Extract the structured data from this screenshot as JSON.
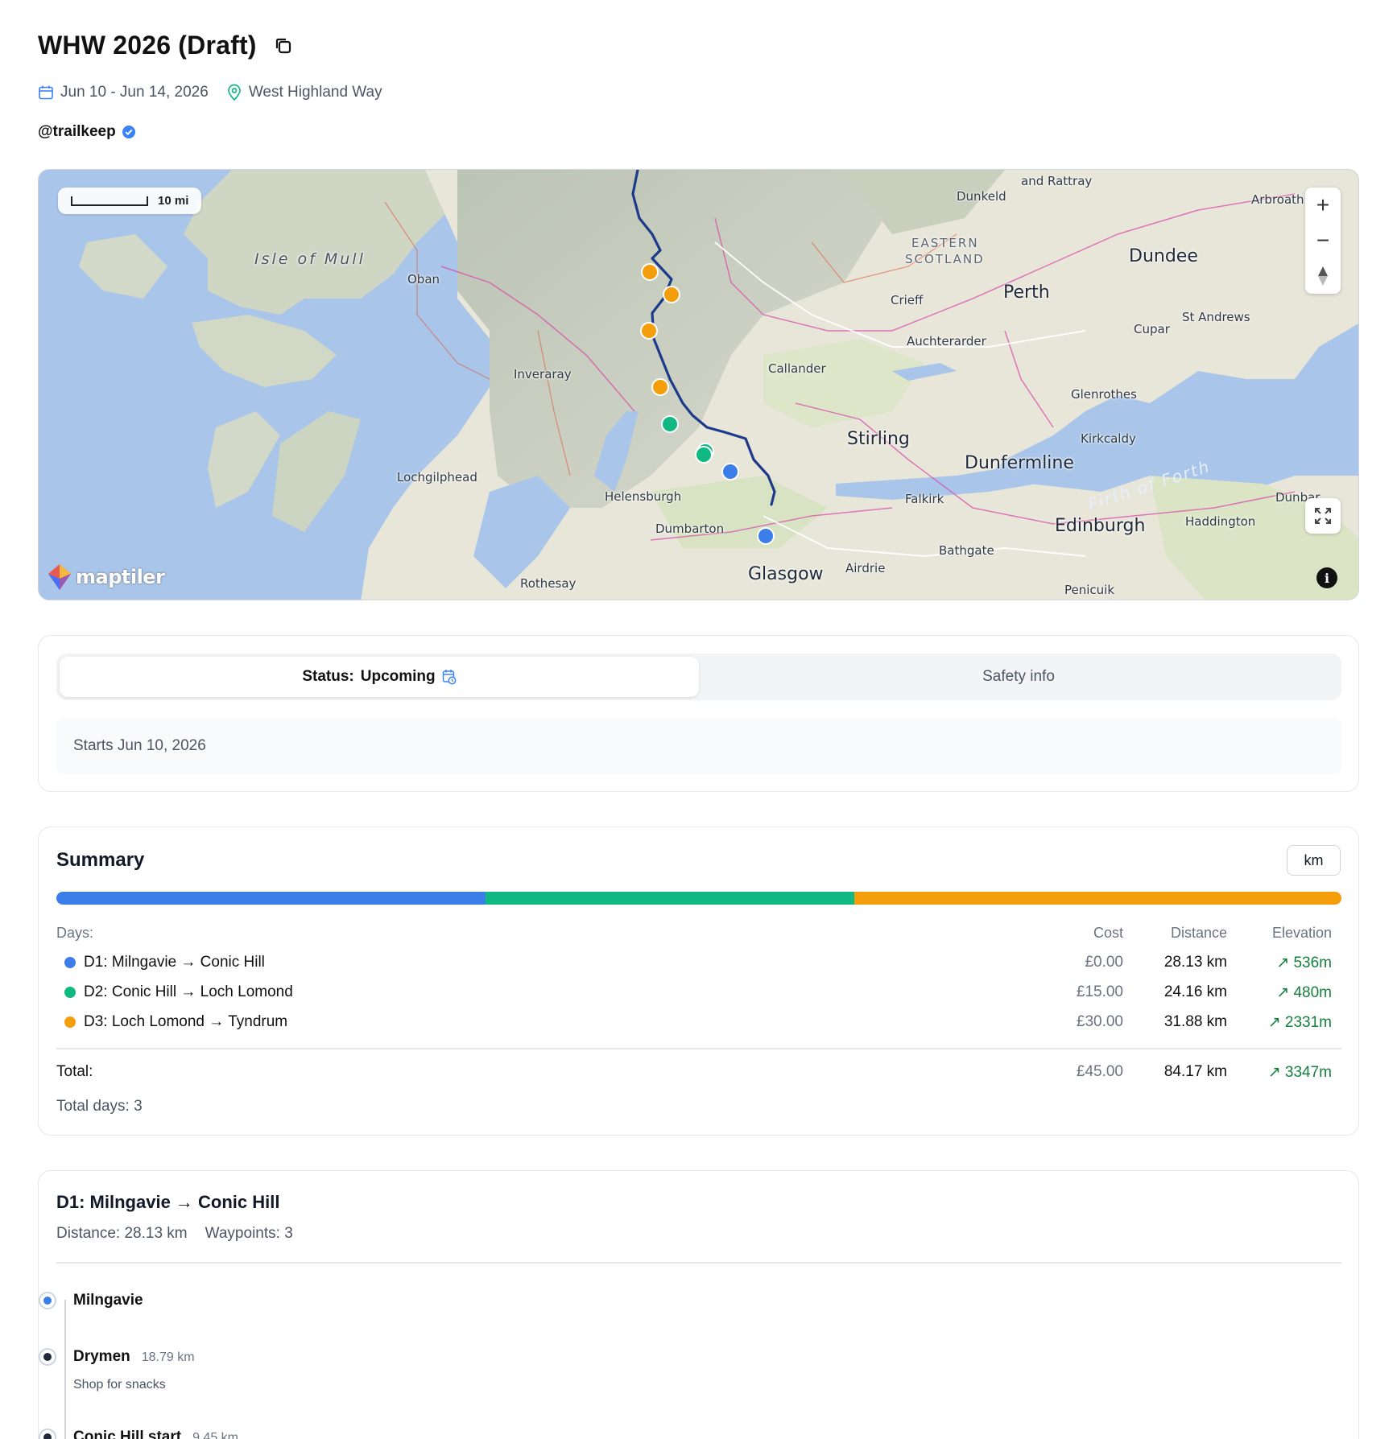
{
  "trip": {
    "title": "WHW 2026 (Draft)",
    "dates": "Jun 10 - Jun 14, 2026",
    "location": "West Highland Way",
    "user": "@trailkeep"
  },
  "map": {
    "scale_label": "10 mi",
    "attribution": "maptiler",
    "labels": {
      "isle_of_mull": "Isle of Mull",
      "oban": "Oban",
      "inveraray": "Inveraray",
      "lochgilphead": "Lochgilphead",
      "helensburgh": "Helensburgh",
      "dumbarton": "Dumbarton",
      "rothesay": "Rothesay",
      "glasgow": "Glasgow",
      "airdrie": "Airdrie",
      "bathgate": "Bathgate",
      "penicuik": "Penicuik",
      "edinburgh": "Edinburgh",
      "haddington": "Haddington",
      "dunbar": "Dunbar",
      "falkirk": "Falkirk",
      "stirling": "Stirling",
      "dunfermline": "Dunfermline",
      "firth_of_forth": "Firth of Forth",
      "kirkcaldy": "Kirkcaldy",
      "glenrothes": "Glenrothes",
      "callander": "Callander",
      "auchterarder": "Auchterarder",
      "crieff": "Crieff",
      "perth": "Perth",
      "cupar": "Cupar",
      "st_andrews": "St Andrews",
      "dundee": "Dundee",
      "arbroath": "Arbroath",
      "dunkeld": "Dunkeld",
      "eastern_scotland_1": "EASTERN",
      "eastern_scotland_2": "SCOTLAND",
      "and_rattray": "and Rattray"
    }
  },
  "status": {
    "label": "Status:",
    "value": "Upcoming",
    "safety_tab": "Safety info",
    "message": "Starts Jun 10, 2026"
  },
  "summary": {
    "title": "Summary",
    "unit": "km",
    "headers": {
      "days": "Days:",
      "cost": "Cost",
      "distance": "Distance",
      "elevation": "Elevation"
    },
    "days": [
      {
        "name": "D1: Milngavie → Conic Hill",
        "cost": "£0.00",
        "distance": "28.13 km",
        "elevation": "↗ 536m",
        "color": "#3b7de9",
        "share": 0.334
      },
      {
        "name": "D2: Conic Hill → Loch Lomond",
        "cost": "£15.00",
        "distance": "24.16 km",
        "elevation": "↗ 480m",
        "color": "#10b981",
        "share": 0.287
      },
      {
        "name": "D3: Loch Lomond → Tyndrum",
        "cost": "£30.00",
        "distance": "31.88 km",
        "elevation": "↗ 2331m",
        "color": "#f59e0b",
        "share": 0.379
      }
    ],
    "total": {
      "label": "Total:",
      "cost": "£45.00",
      "distance": "84.17 km",
      "elevation": "↗ 3347m"
    },
    "total_days": "Total days: 3"
  },
  "day_detail": {
    "title": "D1: Milngavie → Conic Hill",
    "distance": "Distance: 28.13 km",
    "waypoints_count": "Waypoints: 3",
    "waypoints": [
      {
        "name": "Milngavie",
        "distance": "",
        "note": ""
      },
      {
        "name": "Drymen",
        "distance": "18.79 km",
        "note": "Shop for snacks"
      },
      {
        "name": "Conic Hill start",
        "distance": "9.45 km",
        "note": ""
      }
    ]
  },
  "colors": {
    "day1": "#3b7de9",
    "day2": "#10b981",
    "day3": "#f59e0b",
    "route": "#1e3a8a",
    "elevation_positive": "#15803d"
  }
}
